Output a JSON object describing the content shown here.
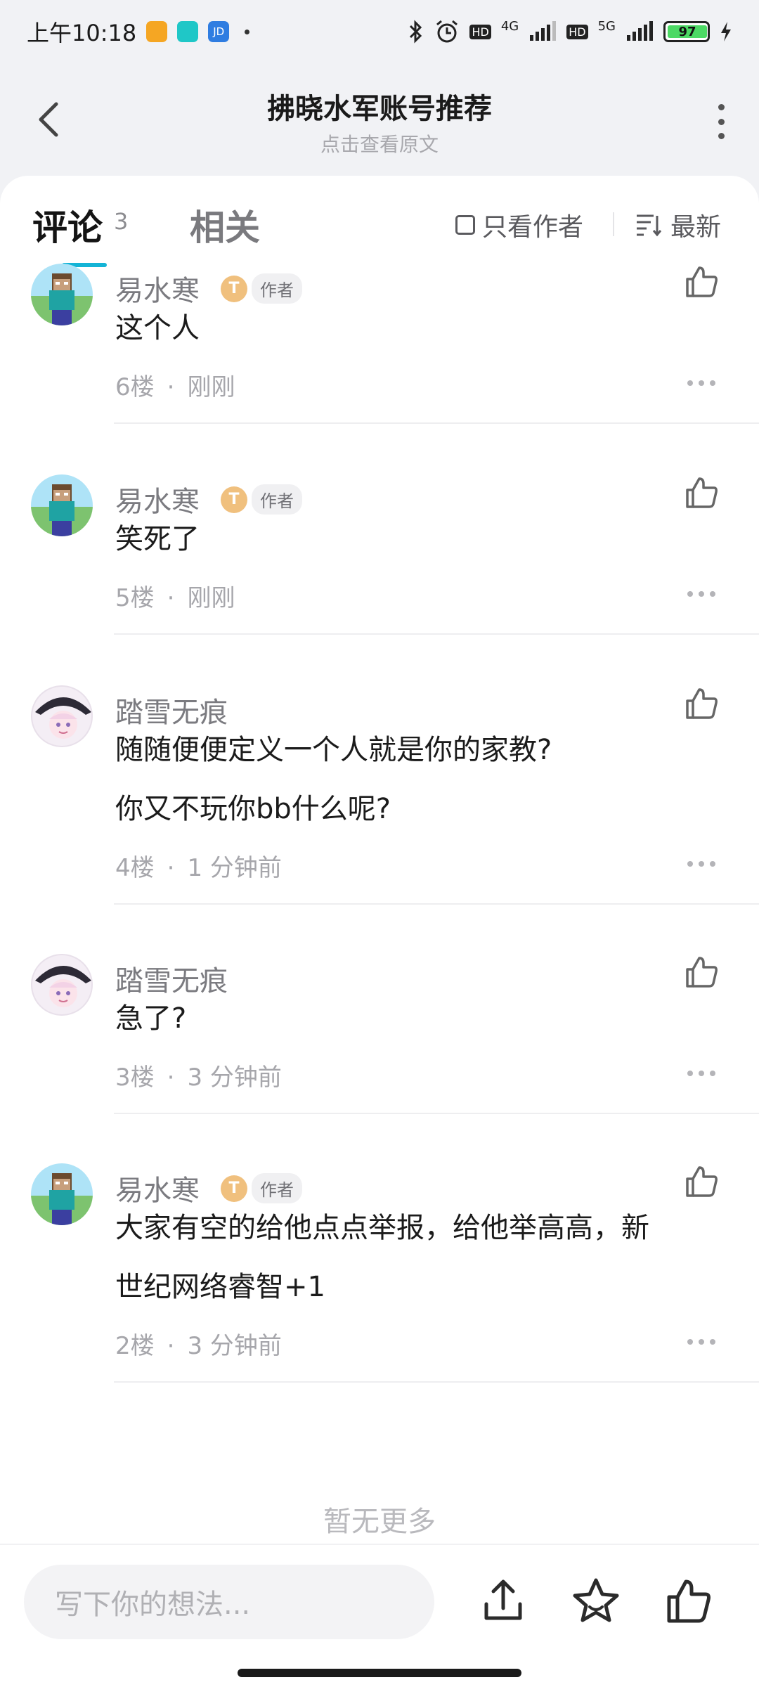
{
  "status_bar": {
    "time": "上午10:18",
    "network_1": "4G",
    "network_2": "5G",
    "hd_1": "HD",
    "hd_2": "HD",
    "battery": "97",
    "app_icons": [
      "orange-app-icon",
      "teal-app-icon",
      "jd-app-icon"
    ],
    "jd_label": "JD"
  },
  "header": {
    "title": "拂晓水军账号推荐",
    "subtitle": "点击查看原文"
  },
  "tabs": {
    "comments_label": "评论",
    "comments_count": "3",
    "related_label": "相关",
    "only_author_label": "只看作者",
    "sort_label": "最新"
  },
  "comments": [
    {
      "username": "易水寒",
      "level": "T",
      "author_tag": "作者",
      "lines": [
        "这个人"
      ],
      "floor": "6楼",
      "time": "刚刚",
      "avatar": "steve"
    },
    {
      "username": "易水寒",
      "level": "T",
      "author_tag": "作者",
      "lines": [
        "笑死了"
      ],
      "floor": "5楼",
      "time": "刚刚",
      "avatar": "steve"
    },
    {
      "username": "踏雪无痕",
      "lines": [
        "随随便便定义一个人就是你的家教?",
        "你又不玩你bb什么呢?"
      ],
      "floor": "4楼",
      "time": "1 分钟前",
      "avatar": "anime"
    },
    {
      "username": "踏雪无痕",
      "lines": [
        "急了?"
      ],
      "floor": "3楼",
      "time": "3 分钟前",
      "avatar": "anime"
    },
    {
      "username": "易水寒",
      "level": "T",
      "author_tag": "作者",
      "lines": [
        "大家有空的给他点点举报，给他举高高，新",
        "世纪网络睿智+1"
      ],
      "floor": "2楼",
      "time": "3 分钟前",
      "avatar": "steve"
    }
  ],
  "footer_text": "暂无更多",
  "bottom_bar": {
    "input_placeholder": "写下你的想法...",
    "icons": [
      "share-icon",
      "star-icon",
      "thumb-up-icon"
    ]
  },
  "colors": {
    "accent": "#14b4d6",
    "level_badge": "#f0c07e",
    "battery": "#4cd964"
  }
}
